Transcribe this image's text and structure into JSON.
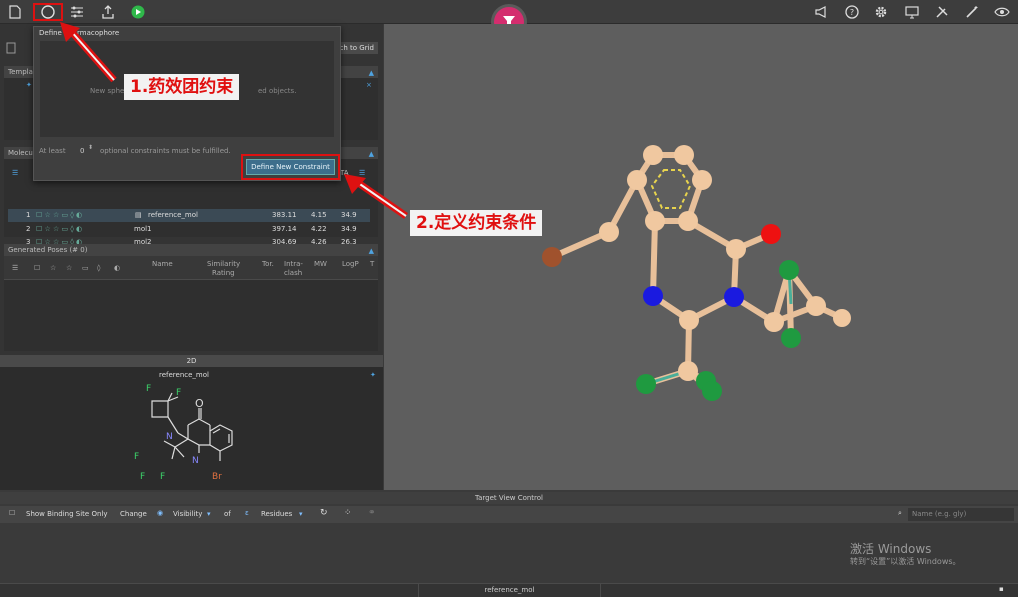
{
  "toolbar": {
    "icons": [
      "new-file-icon",
      "pharmacophore-icon",
      "settings-sliders-icon",
      "export-icon",
      "run-icon"
    ],
    "right_icons": [
      "megaphone-icon",
      "help-icon",
      "gear-icon",
      "display-icon",
      "tools-icon",
      "wand-icon",
      "eye-icon"
    ]
  },
  "popup": {
    "title": "Define Pharmacophore",
    "hint": "New sphe",
    "hint2": "ed objects.",
    "atleast": "At least",
    "count": "0",
    "optional": "optional constraints must be fulfilled.",
    "define_btn": "Define New Constraint"
  },
  "grid_btn": "ch to Grid",
  "template_panel": {
    "title": "Templa"
  },
  "molecules_panel": {
    "title": "Molecu",
    "col_ta": "TA",
    "rows": [
      {
        "idx": "1",
        "name": "reference_mol",
        "mw": "383.11",
        "logp": "4.15",
        "ta": "34.9"
      },
      {
        "idx": "2",
        "name": "mol1",
        "mw": "397.14",
        "logp": "4.22",
        "ta": "34.9"
      },
      {
        "idx": "3",
        "name": "mol2",
        "mw": "304.69",
        "logp": "4.26",
        "ta": "26.3"
      },
      {
        "idx": "4",
        "name": "mol3",
        "mw": "308.66",
        "logp": "3.72",
        "ta": "26.3"
      }
    ]
  },
  "poses_panel": {
    "title": "Generated Poses (# 0)",
    "cols": [
      "Name",
      "Similarity",
      "Rating",
      "Tor.",
      "Intra-",
      "clash",
      "MW",
      "LogP",
      "T"
    ]
  },
  "twod": {
    "title": "2D",
    "mol_name": "reference_mol",
    "atom_o": "O",
    "atom_n1": "N",
    "atom_n2": "N",
    "atom_f1": "F",
    "atom_f2": "F",
    "atom_f3": "F",
    "atom_f4": "F",
    "atom_f5": "F",
    "atom_br": "Br"
  },
  "callouts": {
    "c1": "1.药效团约束",
    "c2": "2.定义约束条件"
  },
  "tvc": {
    "title": "Target View Control",
    "show_binding": "Show Binding Site Only",
    "change": "Change",
    "visibility": "Visibility",
    "of": "of",
    "residues": "Residues",
    "name_placeholder": "Name (e.g. gly)"
  },
  "watermark": {
    "line1": "激活 Windows",
    "line2": "转到“设置”以激活 Windows。"
  },
  "status": {
    "mol": "reference_mol"
  },
  "colors": {
    "logo": "#d42d6e",
    "carbon": "#f0c8a0",
    "nitrogen": "#1a1ae0",
    "oxygen": "#ee1111",
    "fluorine": "#1f9a40",
    "bromine": "#a0522d",
    "accent": "#3d6e8c"
  }
}
